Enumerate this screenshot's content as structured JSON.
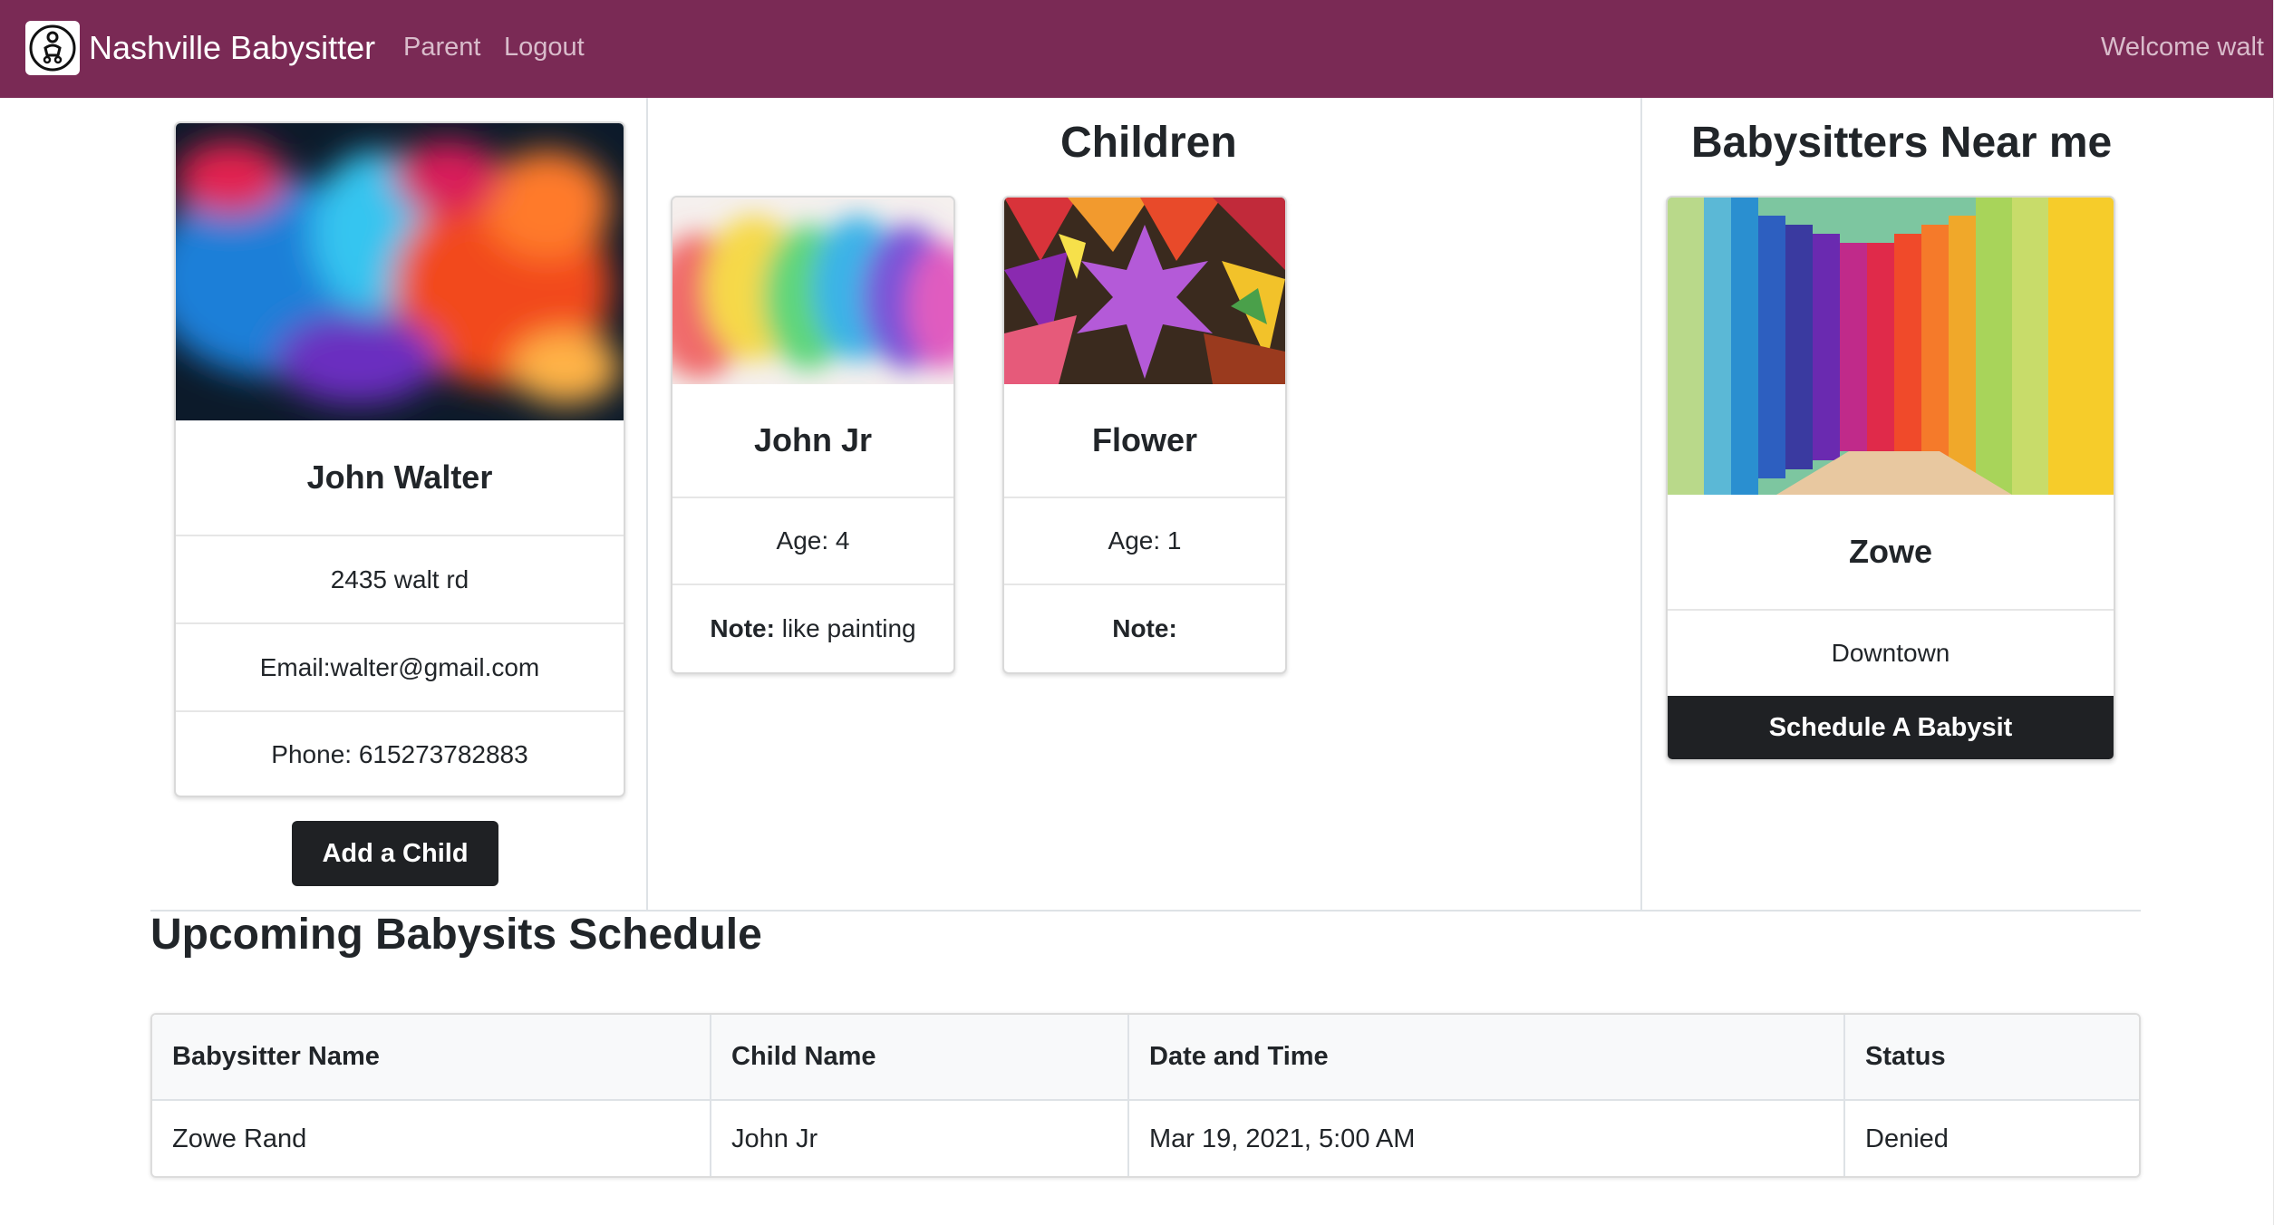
{
  "navbar": {
    "brand": "Nashville Babysitter",
    "links": [
      "Parent",
      "Logout"
    ],
    "welcome": "Welcome walt"
  },
  "parent": {
    "name": "John Walter",
    "address": "2435 walt rd",
    "email": "Email:walter@gmail.com",
    "phone": "Phone: 615273782883",
    "add_child_label": "Add a Child"
  },
  "children": {
    "title": "Children",
    "items": [
      {
        "name": "John Jr",
        "age": "Age: 4",
        "note_label": "Note:",
        "note": " like painting"
      },
      {
        "name": "Flower",
        "age": "Age: 1",
        "note_label": "Note:",
        "note": ""
      }
    ]
  },
  "babysitters": {
    "title": "Babysitters Near me",
    "items": [
      {
        "name": "Zowe",
        "location": "Downtown",
        "button_label": "Schedule A Babysit"
      }
    ]
  },
  "schedule": {
    "title": "Upcoming Babysits Schedule",
    "columns": [
      "Babysitter Name",
      "Child Name",
      "Date and Time",
      "Status"
    ],
    "rows": [
      [
        "Zowe Rand",
        "John Jr",
        "Mar 19, 2021, 5:00 AM",
        "Denied"
      ]
    ]
  },
  "colors": {
    "navbar": "#7a2a55",
    "button": "#1f2124"
  }
}
